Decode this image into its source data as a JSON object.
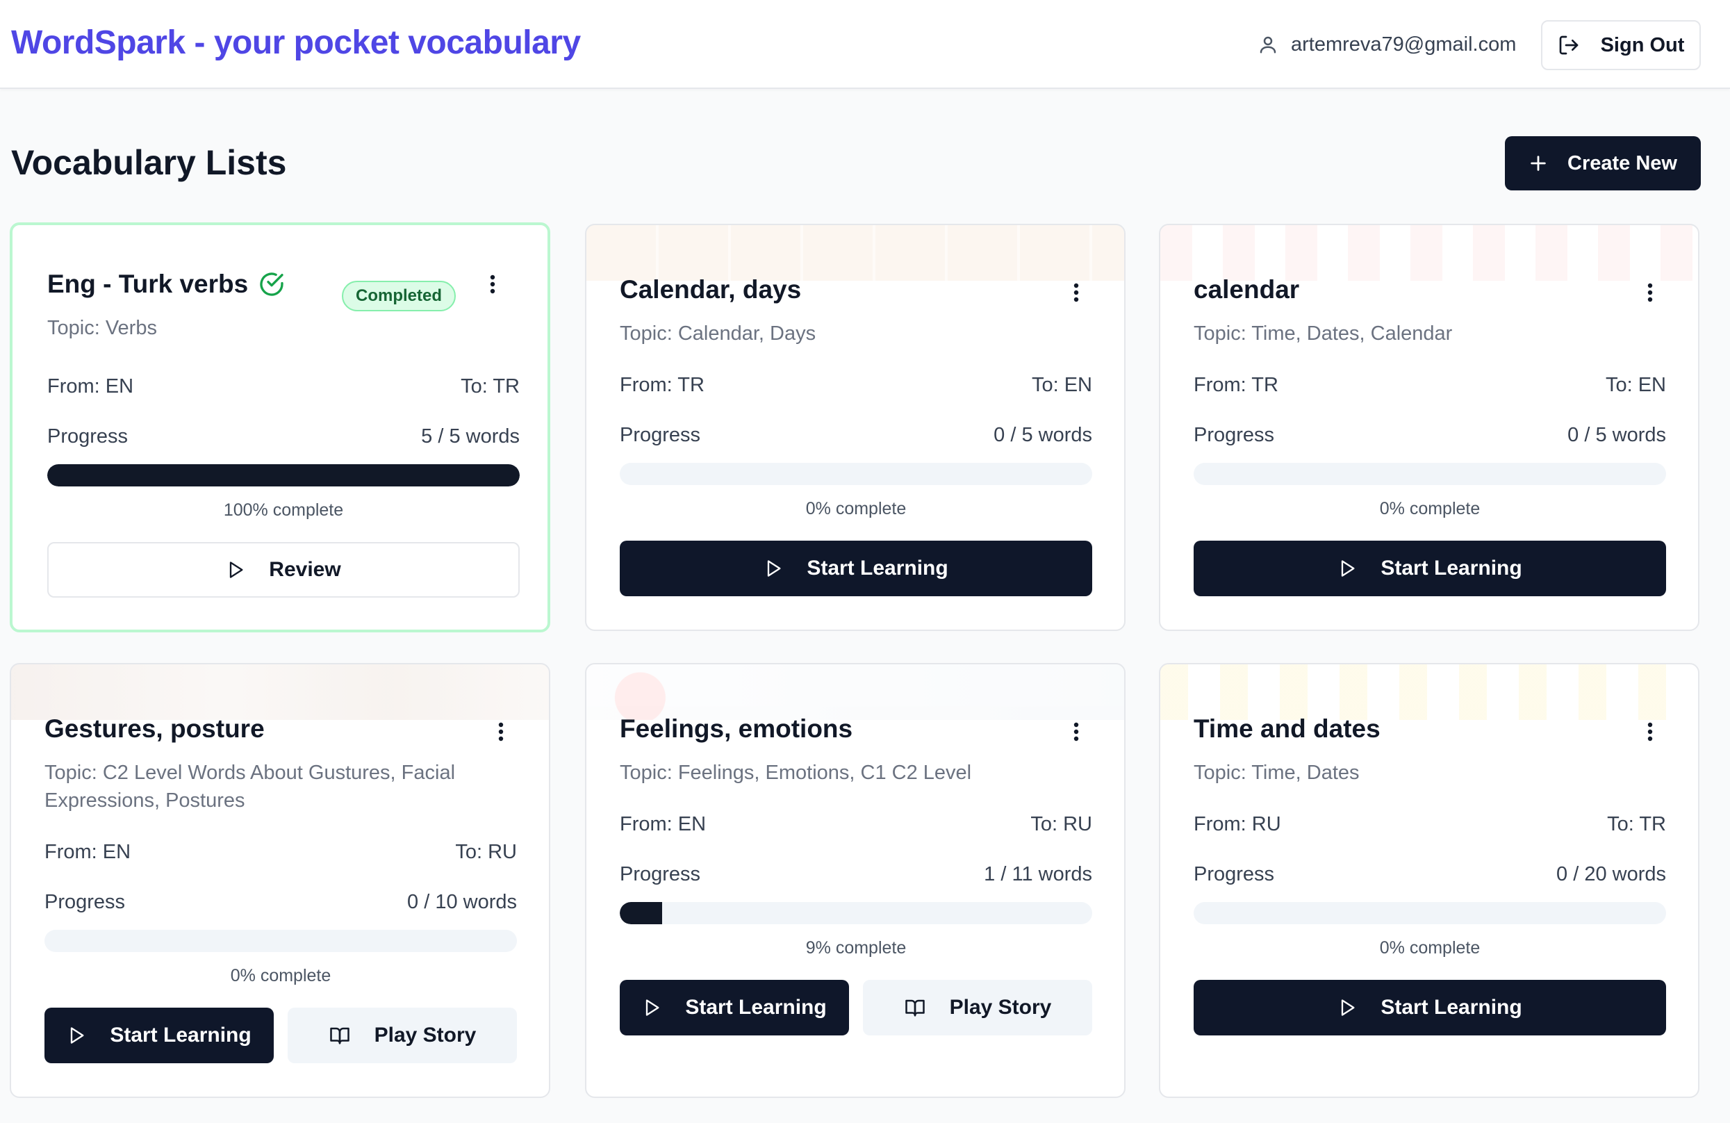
{
  "header": {
    "app_title": "WordSpark - your pocket vocabulary",
    "user_email": "artemreva79@gmail.com",
    "sign_out_label": "Sign Out",
    "brand_color": "#4f46e5"
  },
  "main": {
    "page_title": "Vocabulary Lists",
    "create_label": "Create New"
  },
  "cards": [
    {
      "title": "Eng - Turk verbs",
      "badge": "Completed",
      "topic": "Topic: Verbs",
      "from": "From: EN",
      "to": "To: TR",
      "progress_label": "Progress",
      "progress_words": "5 / 5 words",
      "progress_fraction": 1.0,
      "percent_text": "100% complete",
      "primary_label": "Review"
    },
    {
      "title": "Calendar, days",
      "topic": "Topic: Calendar, Days",
      "from": "From: TR",
      "to": "To: EN",
      "progress_label": "Progress",
      "progress_words": "0 / 5 words",
      "progress_fraction": 0,
      "percent_text": "0% complete",
      "primary_label": "Start Learning"
    },
    {
      "title": "calendar",
      "topic": "Topic: Time, Dates, Calendar",
      "from": "From: TR",
      "to": "To: EN",
      "progress_label": "Progress",
      "progress_words": "0 / 5 words",
      "progress_fraction": 0,
      "percent_text": "0% complete",
      "primary_label": "Start Learning"
    },
    {
      "title": "Gestures, posture",
      "topic": "Topic: C2 Level Words About Gustures, Facial Expressions, Postures",
      "from": "From: EN",
      "to": "To: RU",
      "progress_label": "Progress",
      "progress_words": "0 / 10 words",
      "progress_fraction": 0,
      "percent_text": "0% complete",
      "primary_label": "Start Learning",
      "secondary_label": "Play Story"
    },
    {
      "title": "Feelings, emotions",
      "topic": "Topic: Feelings, Emotions, C1 C2 Level",
      "from": "From: EN",
      "to": "To: RU",
      "progress_label": "Progress",
      "progress_words": "1 / 11 words",
      "progress_fraction": 0.09,
      "percent_text": "9% complete",
      "primary_label": "Start Learning",
      "secondary_label": "Play Story"
    },
    {
      "title": "Time and dates",
      "topic": "Topic: Time, Dates",
      "from": "From: RU",
      "to": "To: TR",
      "progress_label": "Progress",
      "progress_words": "0 / 20 words",
      "progress_fraction": 0,
      "percent_text": "0% complete",
      "primary_label": "Start Learning"
    }
  ]
}
